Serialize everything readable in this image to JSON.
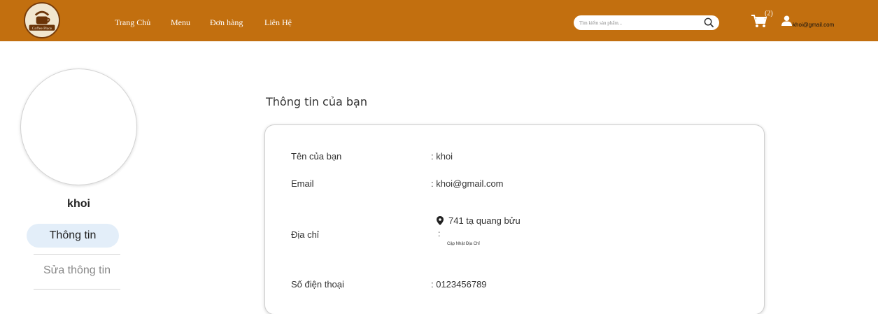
{
  "header": {
    "logo_text": "Coffee Place",
    "nav": [
      "Trang Chủ",
      "Menu",
      "Đơn hàng",
      "Liên Hệ"
    ],
    "search_placeholder": "Tìm kiếm sản phẩm...",
    "cart_count": "(2)",
    "user_email": "khoi@gmail.com",
    "colors": {
      "header_bg": "#c26f0f",
      "text": "#ffffff"
    }
  },
  "sidebar": {
    "name": "khoi",
    "tabs": [
      "Thông tin",
      "Sửa thông tin"
    ],
    "active_tab": "Thông tin"
  },
  "main": {
    "title": "Thông tin của bạn",
    "fields": {
      "name_label": "Tên của bạn",
      "name_value": ": khoi",
      "email_label": "Email",
      "email_value": ": khoi@gmail.com",
      "address_label": "Địa chỉ",
      "address_value": "741 tạ quang bửu",
      "address_colon": ":",
      "update_address": "Cập Nhật Địa Chỉ",
      "phone_label": "Số điện thoại",
      "phone_value": ": 0123456789"
    }
  }
}
